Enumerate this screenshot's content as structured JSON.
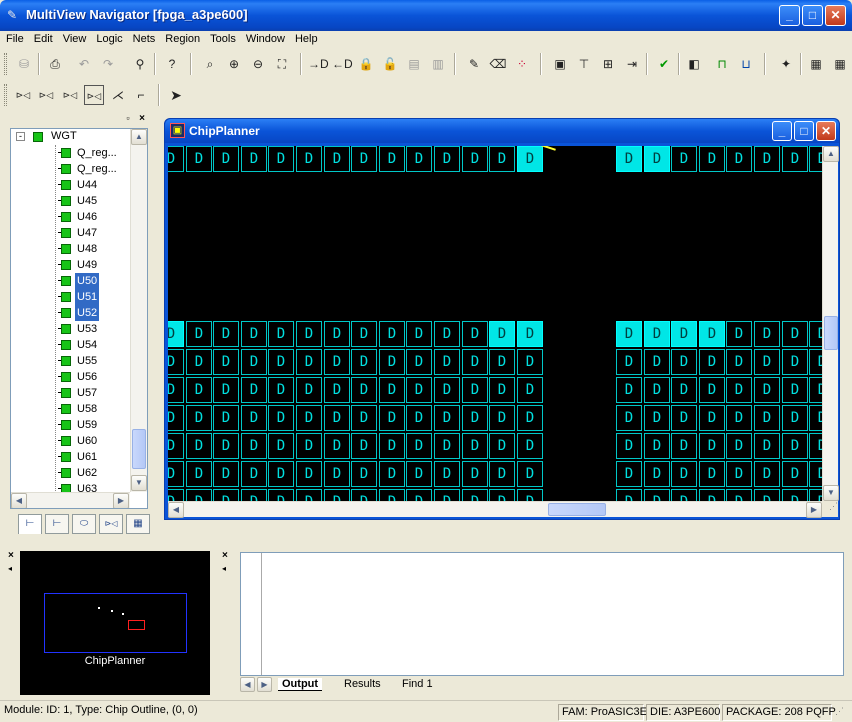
{
  "window": {
    "title": "MultiView Navigator [fpga_a3pe600]"
  },
  "menu": [
    "File",
    "Edit",
    "View",
    "Logic",
    "Nets",
    "Region",
    "Tools",
    "Window",
    "Help"
  ],
  "tree": {
    "root": "WGT",
    "items": [
      {
        "label": "Q_reg...",
        "selected": false
      },
      {
        "label": "Q_reg...",
        "selected": false
      },
      {
        "label": "U44",
        "selected": false
      },
      {
        "label": "U45",
        "selected": false
      },
      {
        "label": "U46",
        "selected": false
      },
      {
        "label": "U47",
        "selected": false
      },
      {
        "label": "U48",
        "selected": false
      },
      {
        "label": "U49",
        "selected": false
      },
      {
        "label": "U50",
        "selected": true
      },
      {
        "label": "U51",
        "selected": true
      },
      {
        "label": "U52",
        "selected": true
      },
      {
        "label": "U53",
        "selected": false
      },
      {
        "label": "U54",
        "selected": false
      },
      {
        "label": "U55",
        "selected": false
      },
      {
        "label": "U56",
        "selected": false
      },
      {
        "label": "U57",
        "selected": false
      },
      {
        "label": "U58",
        "selected": false
      },
      {
        "label": "U59",
        "selected": false
      },
      {
        "label": "U60",
        "selected": false
      },
      {
        "label": "U61",
        "selected": false
      },
      {
        "label": "U62",
        "selected": false
      },
      {
        "label": "U63",
        "selected": false
      }
    ]
  },
  "chipplanner": {
    "title": "ChipPlanner",
    "cell_glyph": "D"
  },
  "navigator": {
    "label": "ChipPlanner"
  },
  "output": {
    "tabs": [
      "Output",
      "Results",
      "Find 1"
    ],
    "active": "Output"
  },
  "status": {
    "module": "Module: ID: 1, Type: Chip Outline, (0, 0)",
    "fam": "FAM: ProASIC3E",
    "die": "DIE: A3PE600",
    "package": "PACKAGE: 208 PQFP"
  }
}
